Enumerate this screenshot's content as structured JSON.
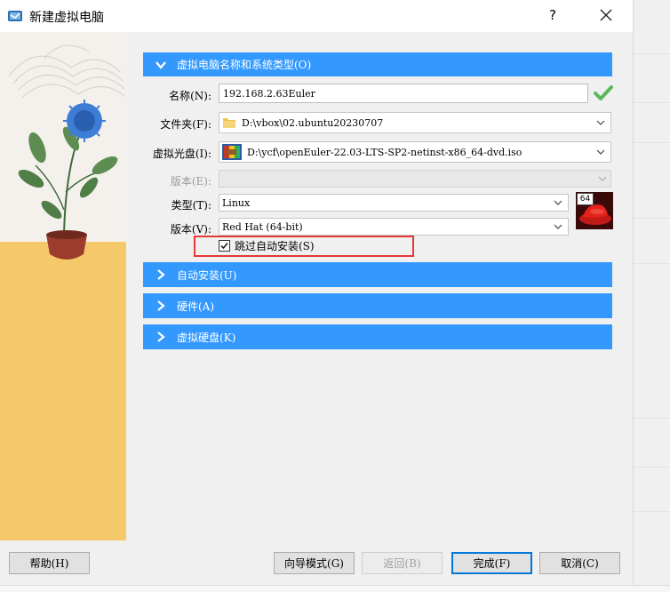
{
  "window": {
    "title": "新建虚拟电脑",
    "help_label": "?"
  },
  "sections": {
    "name_os": {
      "label": "虚拟电脑名称和系统类型(O)",
      "expanded": true
    },
    "unattended": {
      "label": "自动安装(U)"
    },
    "hardware": {
      "label": "硬件(A)"
    },
    "harddisk": {
      "label": "虚拟硬盘(K)"
    }
  },
  "form": {
    "name_label": "名称(N):",
    "name_value": "192.168.2.63Euler",
    "folder_label": "文件夹(F):",
    "folder_value": "D:\\vbox\\02.ubuntu20230707",
    "iso_label": "虚拟光盘(I):",
    "iso_value": "D:\\ycf\\openEuler-22.03-LTS-SP2-netinst-x86_64-dvd.iso",
    "edition_label": "版本(E):",
    "edition_value": "",
    "type_label": "类型(T):",
    "type_value": "Linux",
    "version_label": "版本(V):",
    "version_value": "Red Hat (64-bit)",
    "os_badge": "64",
    "skip_unattended_label": "跳过自动安装(S)",
    "skip_unattended_checked": true
  },
  "buttons": {
    "help": "帮助(H)",
    "guided_mode": "向导模式(G)",
    "back": "返回(B)",
    "finish": "完成(F)",
    "cancel": "取消(C)"
  },
  "colors": {
    "accent": "#3399ff",
    "highlight_box": "#e53935",
    "valid_check": "#5cb85c"
  }
}
